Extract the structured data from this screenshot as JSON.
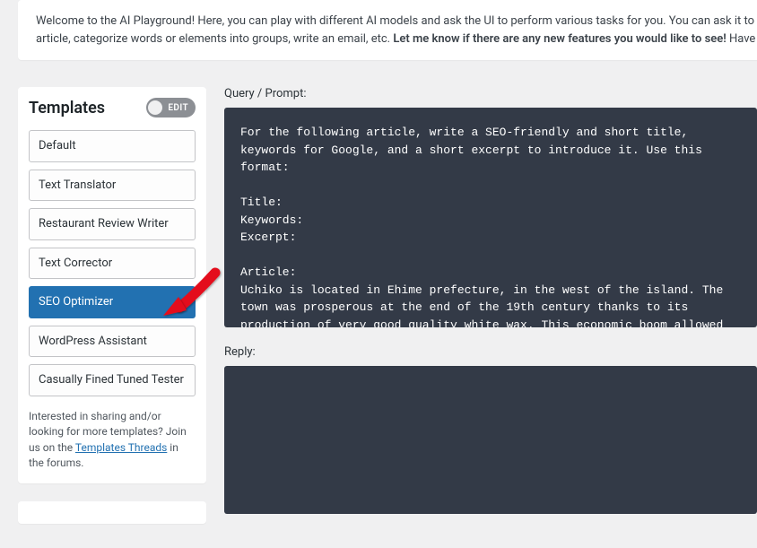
{
  "welcome": {
    "part1": "Welcome to the AI Playground! Here, you can play with different AI models and ask the UI to perform various tasks for you. You can ask it to ",
    "line2_prefix": "article, categorize words or elements into groups, write an email, etc. ",
    "line2_bold": "Let me know if there are any new features you would like to see!",
    "line2_suffix": " Have"
  },
  "sidebar": {
    "title": "Templates",
    "edit_label": "EDIT",
    "items": [
      {
        "label": "Default",
        "active": false
      },
      {
        "label": "Text Translator",
        "active": false
      },
      {
        "label": "Restaurant Review Writer",
        "active": false
      },
      {
        "label": "Text Corrector",
        "active": false
      },
      {
        "label": "SEO Optimizer",
        "active": true
      },
      {
        "label": "WordPress Assistant",
        "active": false
      },
      {
        "label": "Casually Fined Tuned Tester",
        "active": false
      }
    ],
    "hint_prefix": "Interested in sharing and/or looking for more templates? Join us on the ",
    "hint_link": "Templates Threads",
    "hint_suffix": " in the forums."
  },
  "content": {
    "query_label": "Query / Prompt:",
    "reply_label": "Reply:",
    "prompt_value": "For the following article, write a SEO-friendly and short title, keywords for Google, and a short excerpt to introduce it. Use this format:\n\nTitle:\nKeywords:\nExcerpt:\n\nArticle:\nUchiko is located in Ehime prefecture, in the west of the island. The town was prosperous at the end of the 19th century thanks to its production of very good quality white wax. This economic boom allowed wealthy local merchants to build beautiful properties, whose heritage is still visible throughout the town."
  }
}
